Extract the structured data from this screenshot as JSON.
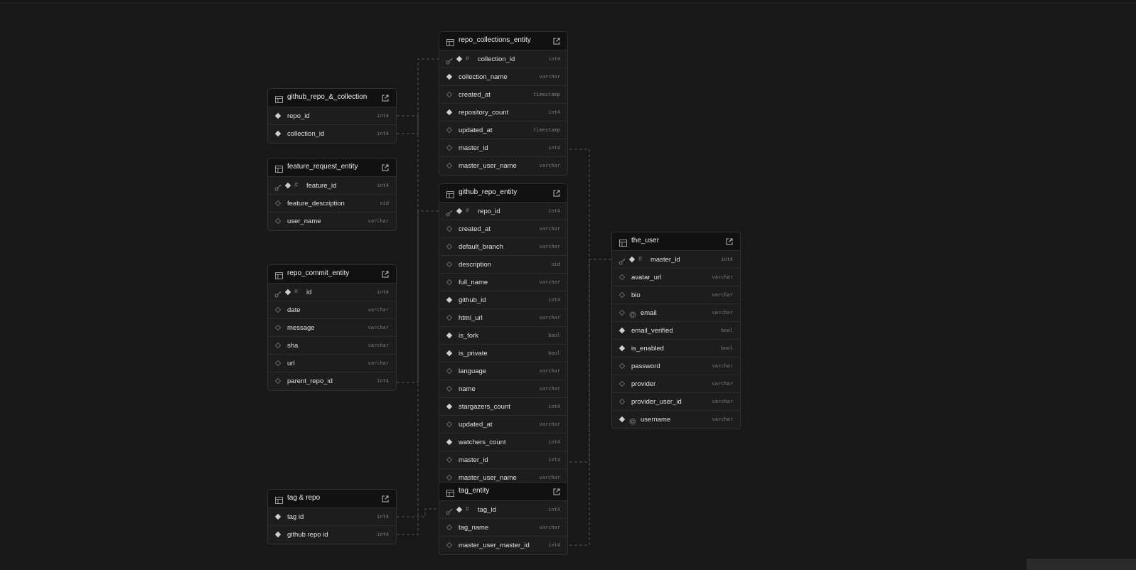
{
  "colors": {
    "canvas": "#181818",
    "table_body": "#1d1d1d",
    "table_header": "#111111",
    "border": "#2f2f2f",
    "text": "#e0e0e0",
    "type_text": "#7b7b7b",
    "connector": "#555555"
  },
  "icons": {
    "table": "table-icon",
    "open": "open-external-icon",
    "primary_key": "key-icon",
    "not_null": "filled-diamond-icon",
    "nullable": "hollow-diamond-icon",
    "identity": "hash-icon",
    "unique": "fingerprint-icon"
  },
  "tables": {
    "repo_collections": {
      "name": "repo_collections_entity",
      "columns": [
        {
          "name": "collection_id",
          "type": "int4",
          "pk": true,
          "required": true
        },
        {
          "name": "collection_name",
          "type": "varchar",
          "required": true
        },
        {
          "name": "created_at",
          "type": "timestamp",
          "required": false
        },
        {
          "name": "repository_count",
          "type": "int4",
          "required": true
        },
        {
          "name": "updated_at",
          "type": "timestamp",
          "required": false
        },
        {
          "name": "master_id",
          "type": "int4",
          "required": false
        },
        {
          "name": "master_user_name",
          "type": "varchar",
          "required": false
        }
      ]
    },
    "github_repo_collection": {
      "name": "github_repo_&_collection",
      "columns": [
        {
          "name": "repo_id",
          "type": "int4",
          "required": true
        },
        {
          "name": "collection_id",
          "type": "int4",
          "required": true
        }
      ]
    },
    "feature_request": {
      "name": "feature_request_entity",
      "columns": [
        {
          "name": "feature_id",
          "type": "int4",
          "pk": true,
          "required": true
        },
        {
          "name": "feature_description",
          "type": "oid",
          "required": false
        },
        {
          "name": "user_name",
          "type": "varchar",
          "required": false
        }
      ]
    },
    "github_repo": {
      "name": "github_repo_entity",
      "columns": [
        {
          "name": "repo_id",
          "type": "int4",
          "pk": true,
          "required": true
        },
        {
          "name": "created_at",
          "type": "varchar",
          "required": false
        },
        {
          "name": "default_branch",
          "type": "varchar",
          "required": false
        },
        {
          "name": "description",
          "type": "oid",
          "required": false
        },
        {
          "name": "full_name",
          "type": "varchar",
          "required": false
        },
        {
          "name": "github_id",
          "type": "int4",
          "required": true
        },
        {
          "name": "html_url",
          "type": "varchar",
          "required": false
        },
        {
          "name": "is_fork",
          "type": "bool",
          "required": true
        },
        {
          "name": "is_private",
          "type": "bool",
          "required": true
        },
        {
          "name": "language",
          "type": "varchar",
          "required": false
        },
        {
          "name": "name",
          "type": "varchar",
          "required": false
        },
        {
          "name": "stargazers_count",
          "type": "int4",
          "required": true
        },
        {
          "name": "updated_at",
          "type": "varchar",
          "required": false
        },
        {
          "name": "watchers_count",
          "type": "int4",
          "required": true
        },
        {
          "name": "master_id",
          "type": "int4",
          "required": false
        },
        {
          "name": "master_user_name",
          "type": "varchar",
          "required": false
        }
      ]
    },
    "the_user": {
      "name": "the_user",
      "columns": [
        {
          "name": "master_id",
          "type": "int4",
          "pk": true,
          "required": true
        },
        {
          "name": "avatar_url",
          "type": "varchar",
          "required": false
        },
        {
          "name": "bio",
          "type": "varchar",
          "required": false
        },
        {
          "name": "email",
          "type": "varchar",
          "required": false,
          "unique": true
        },
        {
          "name": "email_verified",
          "type": "bool",
          "required": true
        },
        {
          "name": "is_enabled",
          "type": "bool",
          "required": true
        },
        {
          "name": "password",
          "type": "varchar",
          "required": false
        },
        {
          "name": "provider",
          "type": "varchar",
          "required": false
        },
        {
          "name": "provider_user_id",
          "type": "varchar",
          "required": false
        },
        {
          "name": "username",
          "type": "varchar",
          "required": true,
          "unique": true
        }
      ]
    },
    "repo_commit": {
      "name": "repo_commit_entity",
      "columns": [
        {
          "name": "id",
          "type": "int4",
          "pk": true,
          "required": true
        },
        {
          "name": "date",
          "type": "varchar",
          "required": false
        },
        {
          "name": "message",
          "type": "varchar",
          "required": false
        },
        {
          "name": "sha",
          "type": "varchar",
          "required": false
        },
        {
          "name": "url",
          "type": "varchar",
          "required": false
        },
        {
          "name": "parent_repo_id",
          "type": "int4",
          "required": false
        }
      ]
    },
    "tag_repo": {
      "name": "tag & repo",
      "columns": [
        {
          "name": "tag id",
          "type": "int4",
          "required": true
        },
        {
          "name": "github repo id",
          "type": "int4",
          "required": true
        }
      ]
    },
    "tag": {
      "name": "tag_entity",
      "columns": [
        {
          "name": "tag_id",
          "type": "int4",
          "pk": true,
          "required": true
        },
        {
          "name": "tag_name",
          "type": "varchar",
          "required": false
        },
        {
          "name": "master_user_master_id",
          "type": "int4",
          "required": false
        }
      ]
    }
  }
}
